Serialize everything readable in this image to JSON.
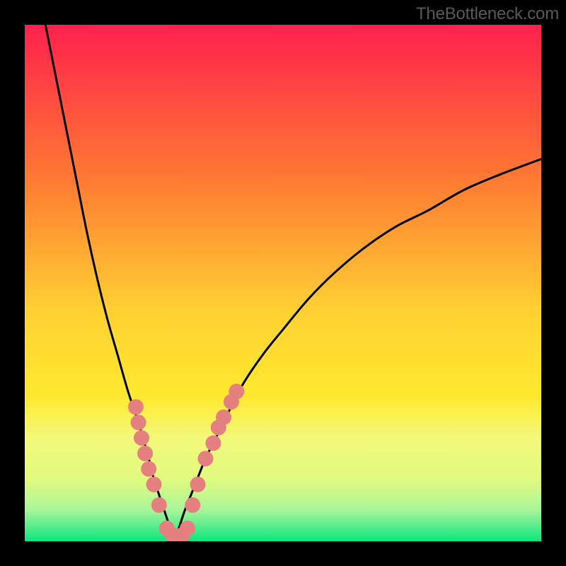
{
  "watermark": "TheBottleneck.com",
  "colors": {
    "black": "#000000",
    "curve": "#000000",
    "dots": "#e48080",
    "gradient_top": "#ff214d",
    "gradient_mid1": "#ff9a2b",
    "gradient_mid2": "#ffe536",
    "gradient_band1": "#f4f97a",
    "gradient_band2": "#e0fa80",
    "gradient_bottom": "#0ce57e"
  },
  "chart_data": {
    "type": "line",
    "title": "",
    "xlabel": "",
    "ylabel": "",
    "xlim": [
      0,
      100
    ],
    "ylim": [
      0,
      100
    ],
    "grid": false,
    "legend": false,
    "series": [
      {
        "name": "left-branch",
        "comment": "Black curve descending from upper-left to minimum near x≈29",
        "x": [
          4,
          6,
          8,
          10,
          12,
          14,
          16,
          18,
          20,
          22,
          24,
          25,
          26,
          27,
          28,
          29
        ],
        "y": [
          100,
          90,
          80,
          70,
          60,
          51,
          43,
          36,
          29,
          23,
          16,
          12,
          9,
          6,
          3,
          0
        ]
      },
      {
        "name": "right-branch",
        "comment": "Black curve rising from minimum near x≈29 asymptotically toward upper-right",
        "x": [
          29,
          30,
          31,
          33,
          35,
          38,
          42,
          46,
          50,
          55,
          60,
          66,
          72,
          78,
          85,
          92,
          100
        ],
        "y": [
          0,
          3,
          6,
          11,
          16,
          22,
          30,
          36,
          41,
          47,
          52,
          57,
          61,
          64,
          68,
          71,
          74
        ]
      }
    ],
    "scatter_overlay": {
      "name": "highlighted-points",
      "comment": "Salmon dot clusters along lower portion of the V",
      "color": "#e48080",
      "points": [
        {
          "x": 21.5,
          "y": 26
        },
        {
          "x": 22.0,
          "y": 23
        },
        {
          "x": 22.6,
          "y": 20
        },
        {
          "x": 23.3,
          "y": 17
        },
        {
          "x": 24.0,
          "y": 14
        },
        {
          "x": 25.0,
          "y": 11
        },
        {
          "x": 26.0,
          "y": 7
        },
        {
          "x": 27.5,
          "y": 2.5
        },
        {
          "x": 28.5,
          "y": 1.3
        },
        {
          "x": 29.5,
          "y": 1.0
        },
        {
          "x": 30.5,
          "y": 1.2
        },
        {
          "x": 31.5,
          "y": 2.5
        },
        {
          "x": 32.5,
          "y": 7
        },
        {
          "x": 33.5,
          "y": 11
        },
        {
          "x": 35.0,
          "y": 16
        },
        {
          "x": 36.5,
          "y": 19
        },
        {
          "x": 37.5,
          "y": 22
        },
        {
          "x": 38.5,
          "y": 24
        },
        {
          "x": 40.0,
          "y": 27
        },
        {
          "x": 41.0,
          "y": 29
        }
      ]
    },
    "background_gradient": {
      "comment": "Vertical gradient fill of plot area, stops approximate y-fraction from top",
      "stops": [
        {
          "pos": 0.0,
          "color": "#ff214d"
        },
        {
          "pos": 0.3,
          "color": "#ff7a33"
        },
        {
          "pos": 0.55,
          "color": "#ffd033"
        },
        {
          "pos": 0.72,
          "color": "#ffe92f"
        },
        {
          "pos": 0.8,
          "color": "#f4f97a"
        },
        {
          "pos": 0.88,
          "color": "#e0fa80"
        },
        {
          "pos": 0.94,
          "color": "#a8f59a"
        },
        {
          "pos": 1.0,
          "color": "#0ce57e"
        }
      ]
    }
  }
}
